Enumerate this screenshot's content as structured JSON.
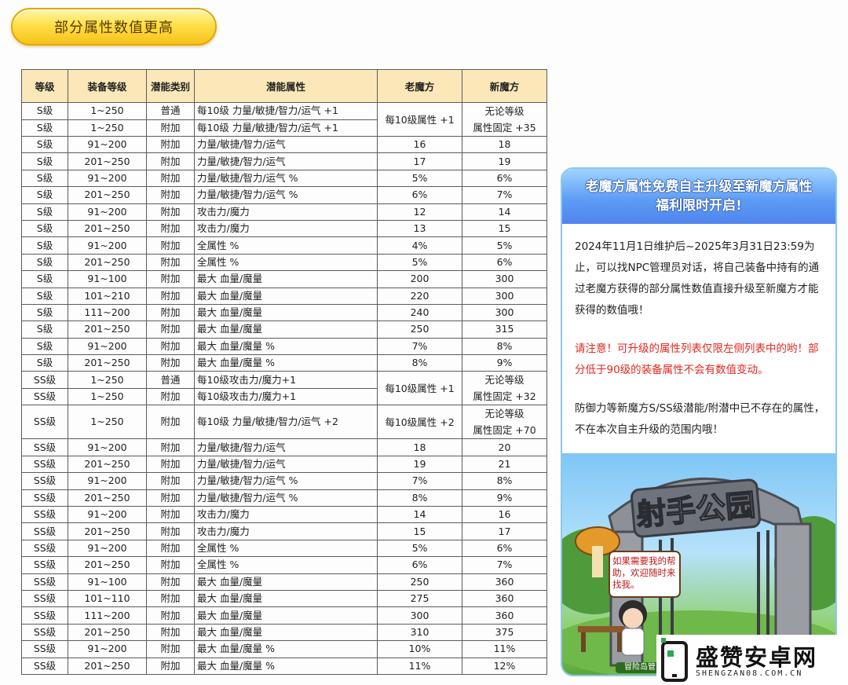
{
  "header": {
    "title": "部分属性数值更高"
  },
  "table": {
    "columns": [
      "等级",
      "装备等级",
      "潜能类别",
      "潜能属性",
      "老魔方",
      "新魔方"
    ],
    "groups": [
      {
        "rows": [
          [
            "S级",
            "1~250",
            "普通",
            "每10级 力量/敏捷/智力/运气 +1"
          ],
          [
            "S级",
            "1~250",
            "附加",
            "每10级 力量/敏捷/智力/运气 +1"
          ]
        ],
        "old": "每10级属性 +1",
        "new1": "无论等级",
        "new2": "属性固定 +35"
      },
      {
        "rows": [
          [
            "S级",
            "91~200",
            "附加",
            "力量/敏捷/智力/运气",
            "16",
            "18"
          ]
        ]
      },
      {
        "rows": [
          [
            "S级",
            "201~250",
            "附加",
            "力量/敏捷/智力/运气",
            "17",
            "19"
          ]
        ]
      },
      {
        "rows": [
          [
            "S级",
            "91~200",
            "附加",
            "力量/敏捷/智力/运气 %",
            "5%",
            "6%"
          ]
        ]
      },
      {
        "rows": [
          [
            "S级",
            "201~250",
            "附加",
            "力量/敏捷/智力/运气 %",
            "6%",
            "7%"
          ]
        ]
      },
      {
        "rows": [
          [
            "S级",
            "91~200",
            "附加",
            "攻击力/魔力",
            "12",
            "14"
          ]
        ]
      },
      {
        "rows": [
          [
            "S级",
            "201~250",
            "附加",
            "攻击力/魔力",
            "13",
            "15"
          ]
        ]
      },
      {
        "rows": [
          [
            "S级",
            "91~200",
            "附加",
            "全属性 %",
            "4%",
            "5%"
          ]
        ]
      },
      {
        "rows": [
          [
            "S级",
            "201~250",
            "附加",
            "全属性 %",
            "5%",
            "6%"
          ]
        ]
      },
      {
        "rows": [
          [
            "S级",
            "91~100",
            "附加",
            "最大 血量/魔量",
            "200",
            "300"
          ]
        ]
      },
      {
        "rows": [
          [
            "S级",
            "101~210",
            "附加",
            "最大 血量/魔量",
            "220",
            "300"
          ]
        ]
      },
      {
        "rows": [
          [
            "S级",
            "111~200",
            "附加",
            "最大 血量/魔量",
            "240",
            "300"
          ]
        ]
      },
      {
        "rows": [
          [
            "S级",
            "201~250",
            "附加",
            "最大 血量/魔量",
            "250",
            "315"
          ]
        ]
      },
      {
        "rows": [
          [
            "S级",
            "91~200",
            "附加",
            "最大 血量/魔量 %",
            "7%",
            "8%"
          ]
        ]
      },
      {
        "rows": [
          [
            "S级",
            "201~250",
            "附加",
            "最大 血量/魔量 %",
            "8%",
            "9%"
          ]
        ]
      },
      {
        "rows": [
          [
            "SS级",
            "1~250",
            "普通",
            "每10级攻击力/魔力+1"
          ],
          [
            "SS级",
            "1~250",
            "附加",
            "每10级攻击力/魔力+1"
          ]
        ],
        "old": "每10级属性 +1",
        "new1": "无论等级",
        "new2": "属性固定 +32"
      },
      {
        "tall": true,
        "rows": [
          [
            "SS级",
            "1~250",
            "附加",
            "每10级 力量/敏捷/智力/运气 +2"
          ]
        ],
        "old": "每10级属性 +2",
        "new1": "无论等级",
        "new2": "属性固定 +70"
      },
      {
        "rows": [
          [
            "SS级",
            "91~200",
            "附加",
            "力量/敏捷/智力/运气",
            "18",
            "20"
          ]
        ]
      },
      {
        "rows": [
          [
            "SS级",
            "201~250",
            "附加",
            "力量/敏捷/智力/运气",
            "19",
            "21"
          ]
        ]
      },
      {
        "rows": [
          [
            "SS级",
            "91~200",
            "附加",
            "力量/敏捷/智力/运气 %",
            "7%",
            "8%"
          ]
        ]
      },
      {
        "rows": [
          [
            "SS级",
            "201~250",
            "附加",
            "力量/敏捷/智力/运气 %",
            "8%",
            "9%"
          ]
        ]
      },
      {
        "rows": [
          [
            "SS级",
            "91~200",
            "附加",
            "攻击力/魔力",
            "14",
            "16"
          ]
        ]
      },
      {
        "rows": [
          [
            "SS级",
            "201~250",
            "附加",
            "攻击力/魔力",
            "15",
            "17"
          ]
        ]
      },
      {
        "rows": [
          [
            "SS级",
            "91~200",
            "附加",
            "全属性 %",
            "5%",
            "6%"
          ]
        ]
      },
      {
        "rows": [
          [
            "SS级",
            "201~250",
            "附加",
            "全属性 %",
            "6%",
            "7%"
          ]
        ]
      },
      {
        "rows": [
          [
            "SS级",
            "91~100",
            "附加",
            "最大 血量/魔量",
            "250",
            "360"
          ]
        ]
      },
      {
        "rows": [
          [
            "SS级",
            "101~110",
            "附加",
            "最大 血量/魔量",
            "275",
            "360"
          ]
        ]
      },
      {
        "rows": [
          [
            "SS级",
            "111~200",
            "附加",
            "最大 血量/魔量",
            "300",
            "360"
          ]
        ]
      },
      {
        "rows": [
          [
            "SS级",
            "201~250",
            "附加",
            "最大 血量/魔量",
            "310",
            "375"
          ]
        ]
      },
      {
        "rows": [
          [
            "SS级",
            "91~200",
            "附加",
            "最大 血量/魔量 %",
            "10%",
            "11%"
          ]
        ]
      },
      {
        "rows": [
          [
            "SS级",
            "201~250",
            "附加",
            "最大 血量/魔量 %",
            "11%",
            "12%"
          ]
        ]
      }
    ]
  },
  "panel": {
    "title_line1": "老魔方属性免费自主升级至新魔方属性",
    "title_line2": "福利限时开启!",
    "para1": "2024年11月1日维护后~2025年3月31日23:59为止，可以找NPC管理员对话，将自己装备中持有的通过老魔方获得的部分属性数值直接升级至新魔方才能获得的数值哦！",
    "notice": "请注意！可升级的属性列表仅限左侧列表中的哟！部分低于90级的装备属性不会有数值变动。",
    "para3": "防御力等新魔方S/SS级潜能/附潜中已不存在的属性，不在本次自主升级的范围内哦！",
    "scene": {
      "sign": "射手公园",
      "bubble": "如果需要我的帮助，欢迎随时来找我。",
      "npc_label": "冒险岛管"
    }
  },
  "watermark": {
    "title": "盛赞安卓网",
    "url": "SHENGZAN08.COM.CN"
  }
}
